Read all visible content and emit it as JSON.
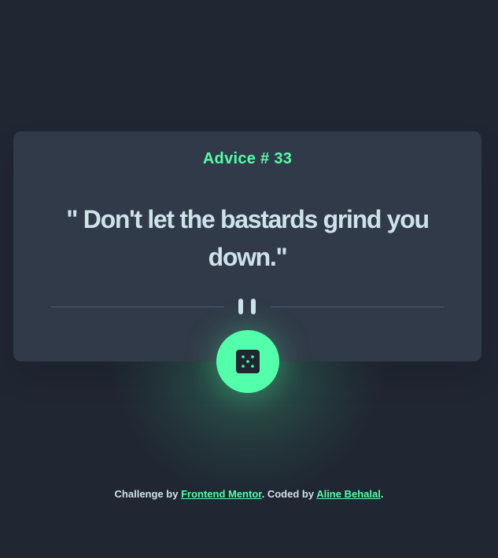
{
  "advice": {
    "heading": "Advice # 33",
    "quote": "\" Don't let the bastards grind you down.\""
  },
  "generate_button": {
    "icon": "dice-icon"
  },
  "footer": {
    "prefix": "Challenge by ",
    "frontend_mentor_link": "Frontend Mentor",
    "middle": ". Coded by ",
    "author_link": "Aline Behalal",
    "suffix": "."
  },
  "colors": {
    "background": "#202632",
    "card": "#313a48",
    "accent": "#53ffaa",
    "text": "#cee3e9",
    "divider": "#4f5d74"
  }
}
